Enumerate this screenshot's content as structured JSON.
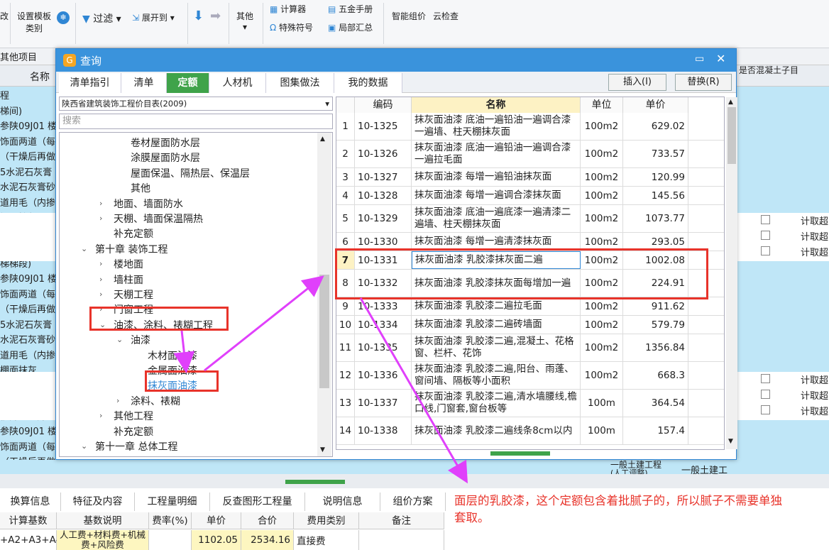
{
  "ribbon": {
    "item0": "改",
    "set_template": "设置模板",
    "set_template2": "类别",
    "filter": "过滤",
    "expand": "展开到",
    "other": "其他",
    "calculator": "计算器",
    "special_symbol": "特殊符号",
    "hardware_manual": "五金手册",
    "partial_summary": "局部汇总",
    "smart_pricing": "智能组价",
    "cloud_check": "云检查"
  },
  "bg": {
    "tab_other": "其他项目",
    "col_name": "名称",
    "col_concrete": "是否混凝土子目",
    "left_rows": [
      "程",
      "梯间)",
      "参陕09J01 楼",
      "饰面两道（每",
      "（干燥后再做",
      "5水泥石灰膏",
      "水泥石灰膏砂",
      "道用毛（内掺",
      "棚面抹灰",
      "醛树脂漆,抹",
      "胶漆抹灰面",
      "梯梯段)",
      "参陕09J01 楼",
      "饰面两道（每",
      "（干燥后再做",
      "5水泥石灰膏",
      "水泥石灰膏砂",
      "道用毛（内掺",
      "棚面抹灰",
      "醛树脂漆,抹",
      "胶漆抹灰面",
      "楼井、电井、",
      "参陕09J01 楼",
      "饰面两道（每",
      "（干燥后再做"
    ],
    "right_calc": "计取超",
    "bottom_row": [
      "一般土建工程",
      "一般土建工",
      "(人工调整)"
    ]
  },
  "dialog": {
    "title": "查询",
    "tabs": [
      "清单指引",
      "清单",
      "定额",
      "人材机",
      "图集做法",
      "我的数据"
    ],
    "active_tab": "定额",
    "insert_btn": "插入(I)",
    "replace_btn": "替换(R)",
    "library": "陕西省建筑装饰工程价目表(2009)",
    "search_placeholder": "搜索",
    "tree": [
      {
        "label": "卷材屋面防水层",
        "arrow": ""
      },
      {
        "label": "涂膜屋面防水层",
        "arrow": ""
      },
      {
        "label": "屋面保温、隔热层、保温层",
        "arrow": ""
      },
      {
        "label": "其他",
        "arrow": ""
      },
      {
        "label": "地面、墙面防水",
        "arrow": "›"
      },
      {
        "label": "天棚、墙面保温隔热",
        "arrow": "›"
      },
      {
        "label": "补充定额",
        "arrow": ""
      },
      {
        "label": "第十章 装饰工程",
        "arrow": "⌄"
      },
      {
        "label": "楼地面",
        "arrow": "›"
      },
      {
        "label": "墙柱面",
        "arrow": "›"
      },
      {
        "label": "天棚工程",
        "arrow": "›"
      },
      {
        "label": "门窗工程",
        "arrow": "›"
      },
      {
        "label": "油漆、涂料、裱糊工程",
        "arrow": "⌄"
      },
      {
        "label": "油漆",
        "arrow": "⌄"
      },
      {
        "label": "木材面油漆",
        "arrow": ""
      },
      {
        "label": "金属面油漆",
        "arrow": ""
      },
      {
        "label": "抹灰面油漆",
        "arrow": ""
      },
      {
        "label": "涂料、裱糊",
        "arrow": "›"
      },
      {
        "label": "其他工程",
        "arrow": "›"
      },
      {
        "label": "补充定额",
        "arrow": ""
      },
      {
        "label": "第十一章 总体工程",
        "arrow": "⌄"
      },
      {
        "label": "总体工程",
        "arrow": ""
      }
    ],
    "table_headers": [
      "编码",
      "名称",
      "单位",
      "单价"
    ],
    "rows": [
      {
        "no": "1",
        "code": "10-1325",
        "name": "抹灰面油漆 底油一遍铅油一遍调合漆一遍墙、柱天棚抹灰面",
        "unit": "100m2",
        "price": "629.02"
      },
      {
        "no": "2",
        "code": "10-1326",
        "name": "抹灰面油漆 底油一遍铅油一遍调合漆一遍拉毛面",
        "unit": "100m2",
        "price": "733.57"
      },
      {
        "no": "3",
        "code": "10-1327",
        "name": "抹灰面油漆 每增一遍铅油抹灰面",
        "unit": "100m2",
        "price": "120.99"
      },
      {
        "no": "4",
        "code": "10-1328",
        "name": "抹灰面油漆 每增一遍调合漆抹灰面",
        "unit": "100m2",
        "price": "145.56"
      },
      {
        "no": "5",
        "code": "10-1329",
        "name": "抹灰面油漆 底油一遍底漆一遍清漆二遍墙、柱天棚抹灰面",
        "unit": "100m2",
        "price": "1073.77"
      },
      {
        "no": "6",
        "code": "10-1330",
        "name": "抹灰面油漆 每增一遍清漆抹灰面",
        "unit": "100m2",
        "price": "293.05"
      },
      {
        "no": "7",
        "code": "10-1331",
        "name": "抹灰面油漆 乳胶漆抹灰面二遍",
        "unit": "100m2",
        "price": "1002.08"
      },
      {
        "no": "8",
        "code": "10-1332",
        "name": "抹灰面油漆 乳胶漆抹灰面每增加一遍",
        "unit": "100m2",
        "price": "224.91"
      },
      {
        "no": "9",
        "code": "10-1333",
        "name": "抹灰面油漆 乳胶漆二遍拉毛面",
        "unit": "100m2",
        "price": "911.62"
      },
      {
        "no": "10",
        "code": "10-1334",
        "name": "抹灰面油漆 乳胶漆二遍砖墙面",
        "unit": "100m2",
        "price": "579.79"
      },
      {
        "no": "11",
        "code": "10-1335",
        "name": "抹灰面油漆 乳胶漆二遍,混凝土、花格窗、栏杆、花饰",
        "unit": "100m2",
        "price": "1356.84"
      },
      {
        "no": "12",
        "code": "10-1336",
        "name": "抹灰面油漆 乳胶漆二遍,阳台、雨蓬、窗间墙、隔板等小面积",
        "unit": "100m2",
        "price": "668.3"
      },
      {
        "no": "13",
        "code": "10-1337",
        "name": "抹灰面油漆 乳胶漆二遍,清水墙腰线,檐口线,门窗套,窗台板等",
        "unit": "100m",
        "price": "364.54"
      },
      {
        "no": "14",
        "code": "10-1338",
        "name": "抹灰面油漆 乳胶漆二遍线条8cm以内",
        "unit": "100m",
        "price": "157.4"
      }
    ]
  },
  "annotation": "面层的乳胶漆，这个定额包含着批腻子的，所以腻子不需要单独套取。",
  "bottom": {
    "tabs": [
      "换算信息",
      "特征及内容",
      "工程量明细",
      "反查图形工程量",
      "说明信息",
      "组价方案"
    ],
    "headers": [
      "计算基数",
      "基数说明",
      "费率(%)",
      "单价",
      "合价",
      "费用类别",
      "备注"
    ],
    "row": [
      "+A2+A3+A4",
      "人工费+材料费+机械费+风险费",
      "",
      "1102.05",
      "2534.16",
      "直接费",
      ""
    ]
  },
  "colors": {
    "accent": "#3a93dc",
    "active_tab": "#3fa34a",
    "highlight": "#e8332a",
    "arrow": "#e040fb",
    "annotation": "#e8332a"
  }
}
